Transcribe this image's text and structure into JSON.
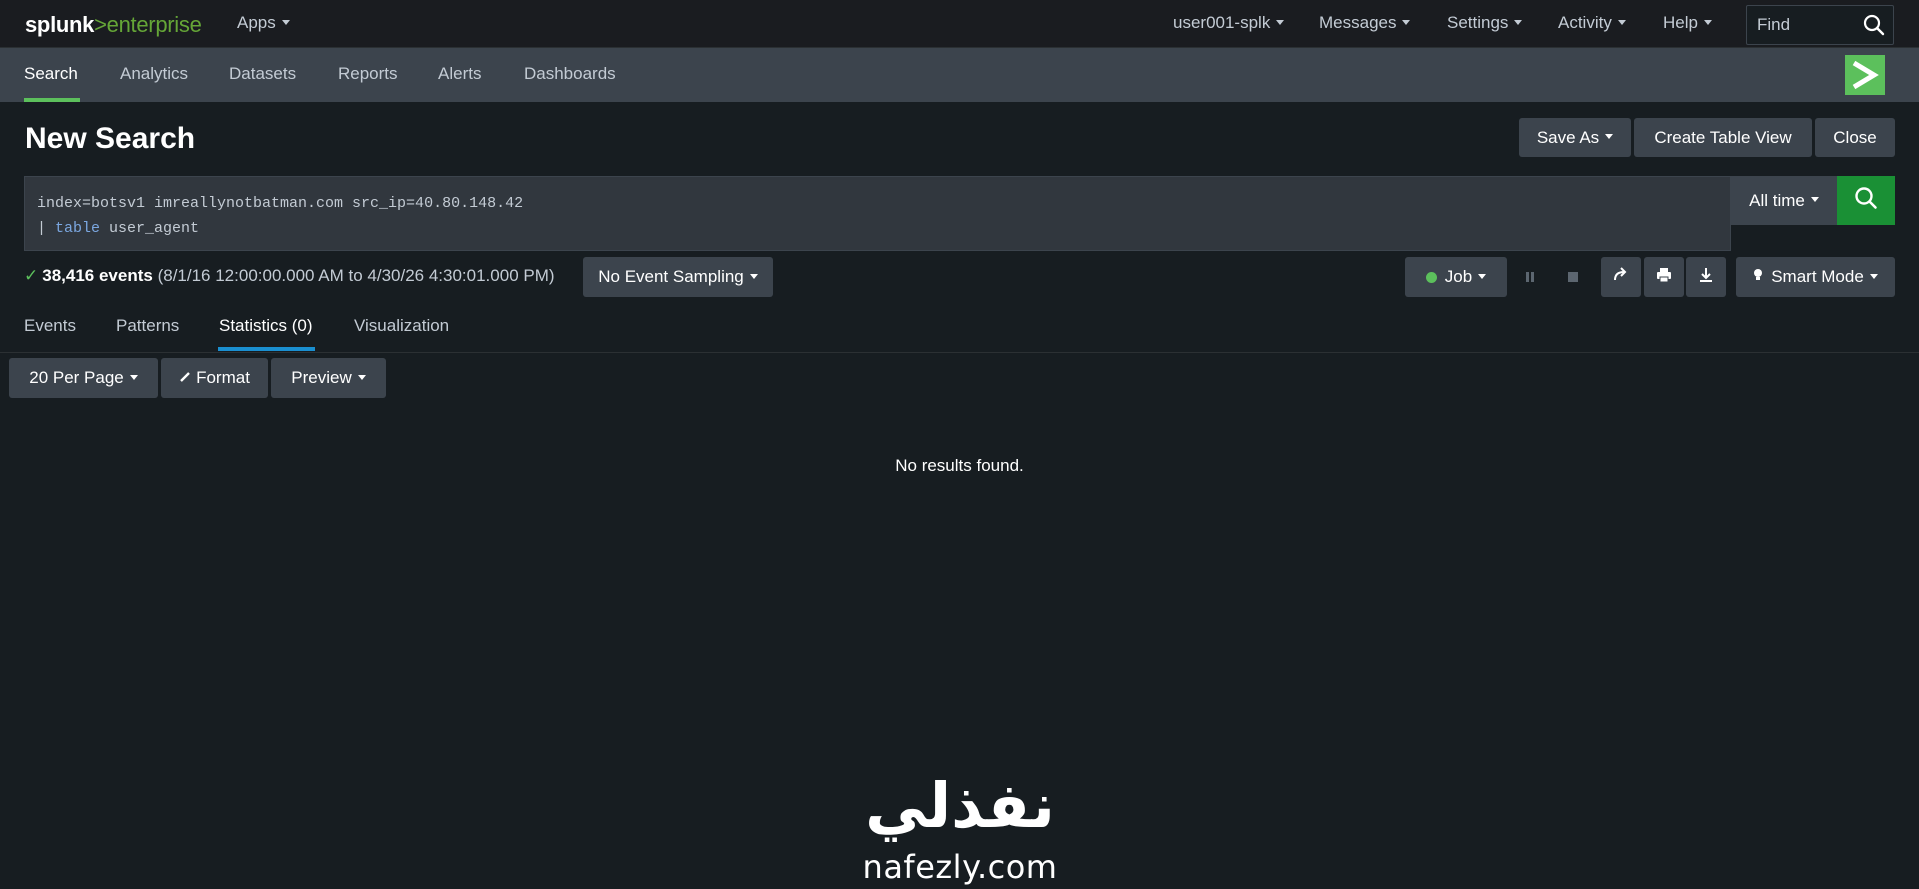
{
  "topbar": {
    "logo_prefix": "splunk",
    "logo_gt": ">",
    "logo_suffix": "enterprise",
    "apps_label": "Apps",
    "user_label": "user001-splk",
    "messages_label": "Messages",
    "settings_label": "Settings",
    "activity_label": "Activity",
    "help_label": "Help",
    "find_placeholder": "Find"
  },
  "appbar": {
    "items": [
      {
        "label": "Search"
      },
      {
        "label": "Analytics"
      },
      {
        "label": "Datasets"
      },
      {
        "label": "Reports"
      },
      {
        "label": "Alerts"
      },
      {
        "label": "Dashboards"
      }
    ],
    "active": "Search"
  },
  "page": {
    "title": "New Search",
    "save_as_label": "Save As",
    "create_table_view_label": "Create Table View",
    "close_label": "Close"
  },
  "search": {
    "line1": "index=botsv1 imreallynotbatman.com src_ip=40.80.148.42",
    "line2_pipe": "| ",
    "line2_command": "table",
    "line2_rest": " user_agent",
    "time_range_label": "All time"
  },
  "status": {
    "event_count": "38,416 events",
    "time_range": "(8/1/16 12:00:00.000 AM to 4/30/26 4:30:01.000 PM)",
    "sampling_label": "No Event Sampling",
    "job_label": "Job",
    "mode_label": "Smart Mode"
  },
  "tabs": [
    {
      "label": "Events"
    },
    {
      "label": "Patterns"
    },
    {
      "label": "Statistics (0)"
    },
    {
      "label": "Visualization"
    }
  ],
  "toolbar": {
    "per_page_label": "20 Per Page",
    "format_label": "Format",
    "preview_label": "Preview"
  },
  "results": {
    "empty_message": "No results found."
  },
  "watermark": {
    "arabic": "نفذلي",
    "latin": "nafezly.com"
  },
  "colors": {
    "accent_green": "#5cc05c",
    "search_green": "#1a9035",
    "tab_blue": "#1a8fd0",
    "bar_gray": "#3c444d",
    "background": "#171d21"
  }
}
